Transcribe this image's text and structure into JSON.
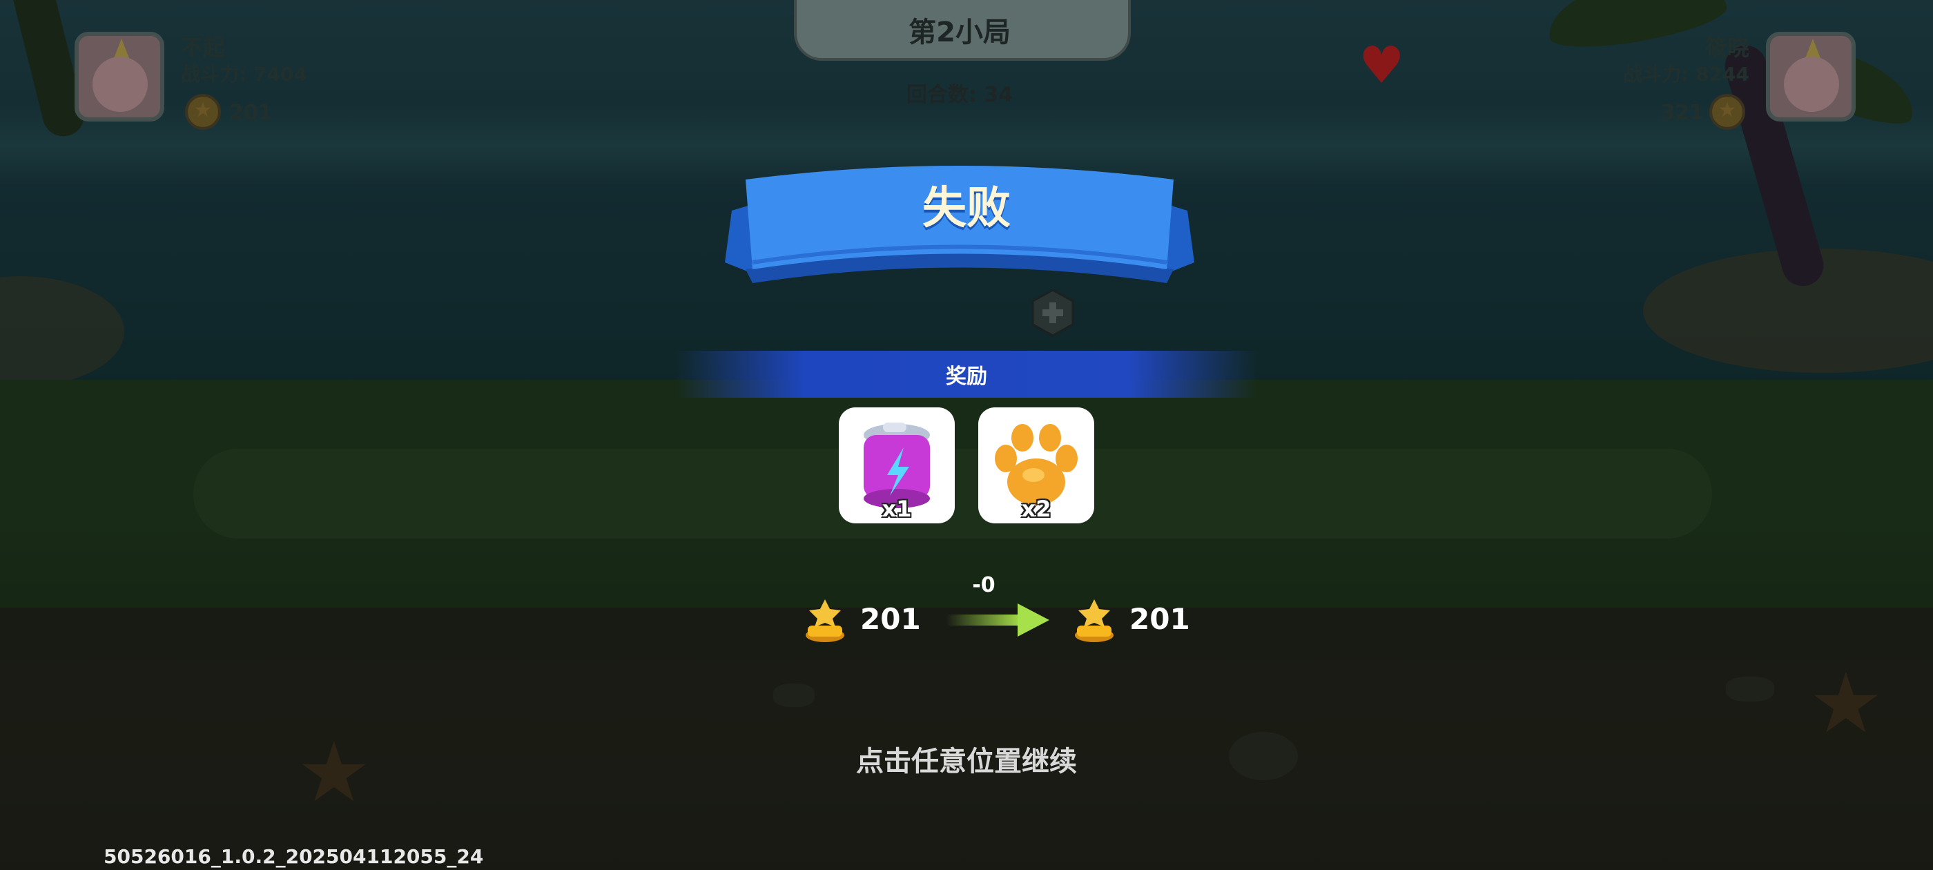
{
  "match": {
    "round_title": "第2小局",
    "turns": "回合数: 34"
  },
  "player_left": {
    "name": "不起",
    "power": "战斗力: 7404",
    "score": "201"
  },
  "player_right": {
    "name": "筱晓",
    "power": "战斗力: 8244",
    "score": "321"
  },
  "result": {
    "title": "失败",
    "reward_label": "奖励",
    "rewards": [
      {
        "icon": "energy-drink-can-icon",
        "qty": "x1"
      },
      {
        "icon": "golden-paw-icon",
        "qty": "x2"
      }
    ],
    "trophy_before": "201",
    "trophy_delta": "-0",
    "trophy_after": "201",
    "continue_hint": "点击任意位置继续"
  },
  "version": "50526016_1.0.2_202504112055_24",
  "colors": {
    "ribbon_blue": "#3b8df0",
    "reward_bar_blue": "#2148c0",
    "arrow_green": "#a6e04a",
    "trophy_gold": "#f6b81c"
  }
}
